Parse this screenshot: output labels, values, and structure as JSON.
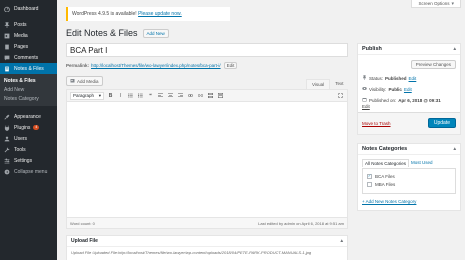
{
  "sidebar": {
    "items": [
      {
        "label": "Dashboard",
        "icon": "dashboard-icon"
      },
      {
        "label": "Posts",
        "icon": "pin-icon"
      },
      {
        "label": "Media",
        "icon": "media-icon"
      },
      {
        "label": "Pages",
        "icon": "page-icon"
      },
      {
        "label": "Comments",
        "icon": "comment-icon"
      },
      {
        "label": "Notes & Files",
        "icon": "notes-icon"
      }
    ],
    "submenu": [
      "Notes & Files",
      "Add New",
      "Notes Category"
    ],
    "items2": [
      {
        "label": "Appearance",
        "icon": "brush-icon"
      },
      {
        "label": "Plugins",
        "icon": "plugin-icon",
        "badge": "4"
      },
      {
        "label": "Users",
        "icon": "users-icon"
      },
      {
        "label": "Tools",
        "icon": "wrench-icon"
      },
      {
        "label": "Settings",
        "icon": "settings-icon"
      },
      {
        "label": "Collapse menu",
        "icon": "collapse-icon"
      }
    ]
  },
  "screen_options": "Screen Options",
  "notice": {
    "prefix": "WordPress 4.9.5 is available!",
    "link": "Please update now."
  },
  "heading": {
    "title": "Edit Notes & Files",
    "add_new": "Add New"
  },
  "post": {
    "title": "BCA Part I",
    "permalink_label": "Permalink:",
    "permalink_url": "http://localhost/Themes/file/wo-lawyer/index.php/notes/bca-part-i/",
    "permalink_edit": "Edit"
  },
  "editor": {
    "add_media": "Add Media",
    "tab_visual": "Visual",
    "tab_text": "Text",
    "format": "Paragraph",
    "word_count": "Word count: 0",
    "last_edited": "Last edited by admin on April 6, 2018 at 9:51 am"
  },
  "upload": {
    "title": "Upload File",
    "text": "Upload File Uploaded File:http://localhost/Themes/file/wo-lawyer/wp-content/uploads/2018/04/PETE-PARK-PRODUCT-MANUALS-1.jpg"
  },
  "publish": {
    "title": "Publish",
    "preview": "Preview Changes",
    "status_label": "Status:",
    "status_value": "Published",
    "status_edit": "Edit",
    "visibility_label": "Visibility:",
    "visibility_value": "Public",
    "visibility_edit": "Edit",
    "published_label": "Published on:",
    "published_value": "Apr 6, 2018 @ 09:31",
    "published_edit": "Edit",
    "trash": "Move to Trash",
    "update": "Update"
  },
  "categories": {
    "title": "Notes Categories",
    "tab_all": "All Notes Categories",
    "tab_most": "Most Used",
    "items": [
      {
        "label": "BCA Files",
        "checked": true
      },
      {
        "label": "MBA Files",
        "checked": false
      }
    ],
    "add_new": "+ Add New Notes Category"
  }
}
